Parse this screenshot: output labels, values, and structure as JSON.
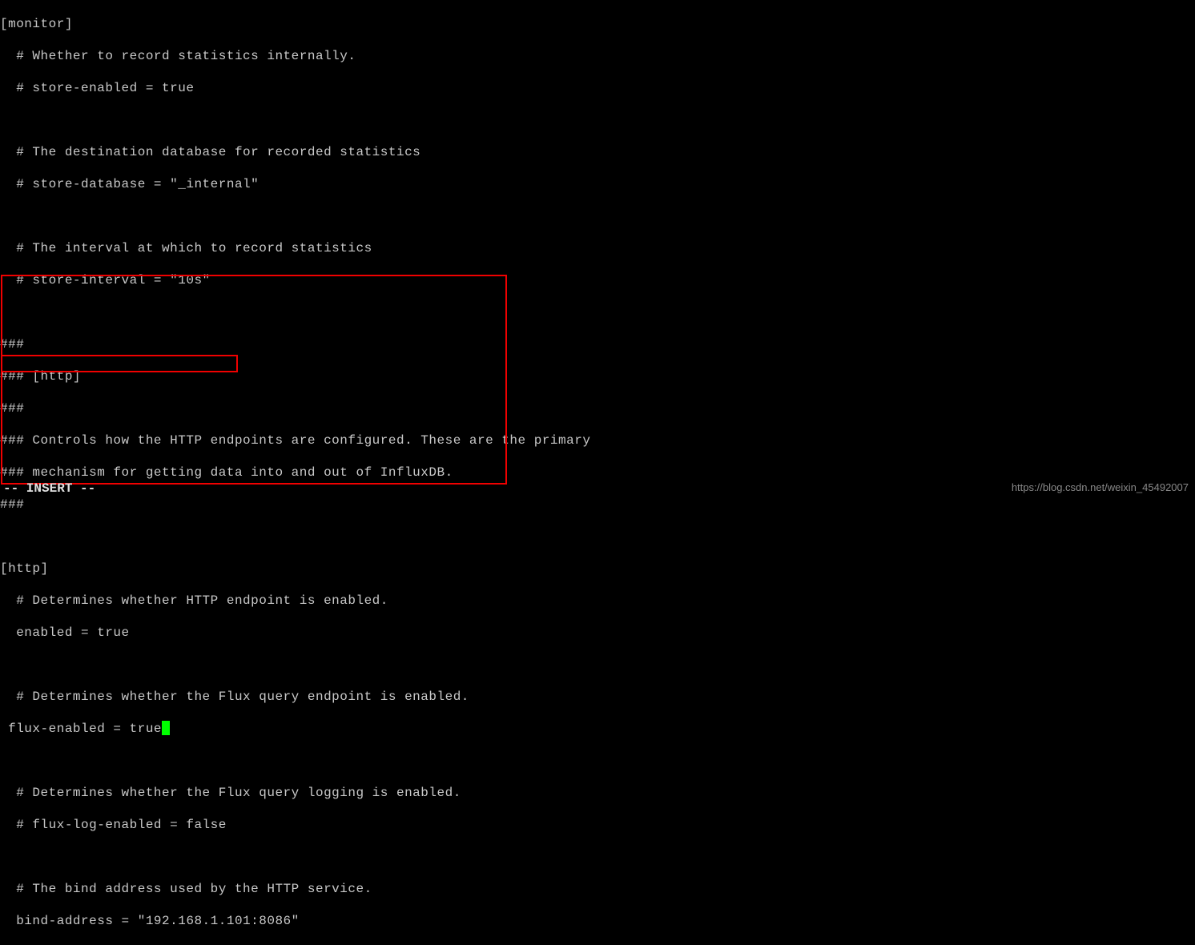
{
  "terminal": {
    "lines": [
      "[monitor]",
      "  # Whether to record statistics internally.",
      "  # store-enabled = true",
      "",
      "  # The destination database for recorded statistics",
      "  # store-database = \"_internal\"",
      "",
      "  # The interval at which to record statistics",
      "  # store-interval = \"10s\"",
      "",
      "###",
      "### [http]",
      "###",
      "### Controls how the HTTP endpoints are configured. These are the primary",
      "### mechanism for getting data into and out of InfluxDB.",
      "###",
      "",
      "[http]",
      "  # Determines whether HTTP endpoint is enabled.",
      "  enabled = true",
      "",
      "  # Determines whether the Flux query endpoint is enabled.",
      " flux-enabled = true",
      "",
      "  # Determines whether the Flux query logging is enabled.",
      "  # flux-log-enabled = false",
      "",
      "  # The bind address used by the HTTP service.",
      "  bind-address = \"192.168.1.101:8086\""
    ],
    "cursor_line_index": 22,
    "mode": "-- INSERT --"
  },
  "watermark": "https://blog.csdn.net/weixin_45492007"
}
